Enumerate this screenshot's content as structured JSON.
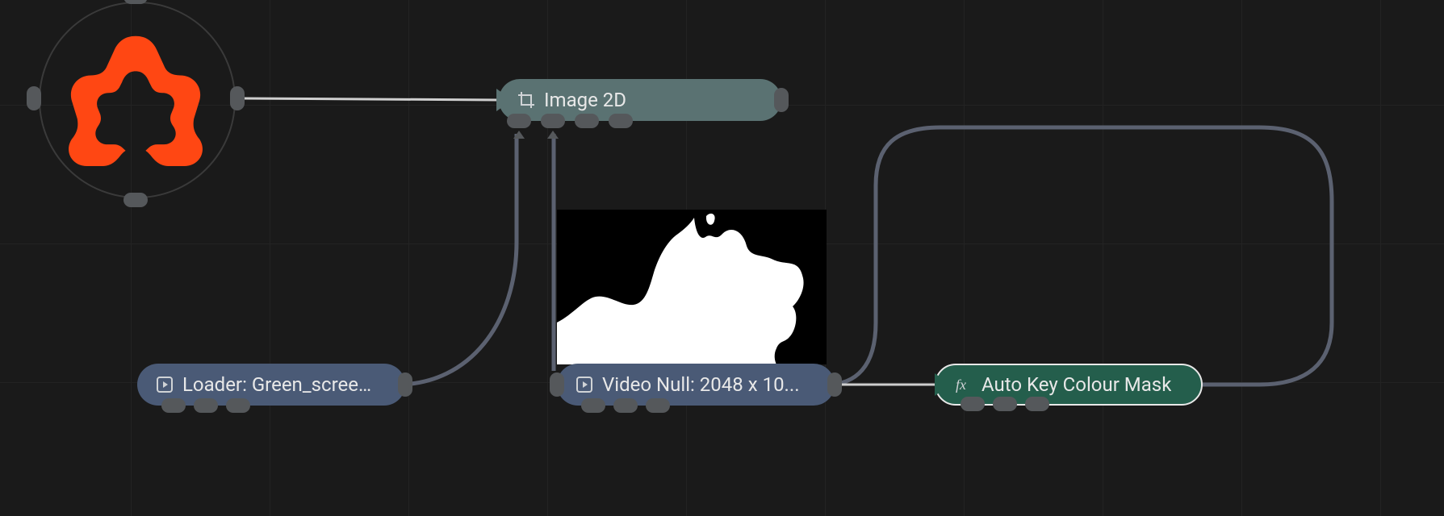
{
  "nodes": {
    "image2d": {
      "label": "Image 2D",
      "icon": "crop-icon"
    },
    "loader": {
      "label": "Loader: Green_screen ...",
      "icon": "play-icon"
    },
    "videonull": {
      "label": "Video Null: 2048 x 10...",
      "icon": "play-icon"
    },
    "autokey": {
      "label": "Auto Key Colour Mask",
      "icon": "fx-icon"
    }
  },
  "hub": {
    "name": "project-hub"
  },
  "colors": {
    "accent": "#ff4713",
    "node_blue": "#4a5a76",
    "node_teal": "#5a7272",
    "node_green": "#245e4c",
    "port": "#55585b",
    "wire_light": "#9aa0a6",
    "wire_dark": "#5b6170"
  }
}
